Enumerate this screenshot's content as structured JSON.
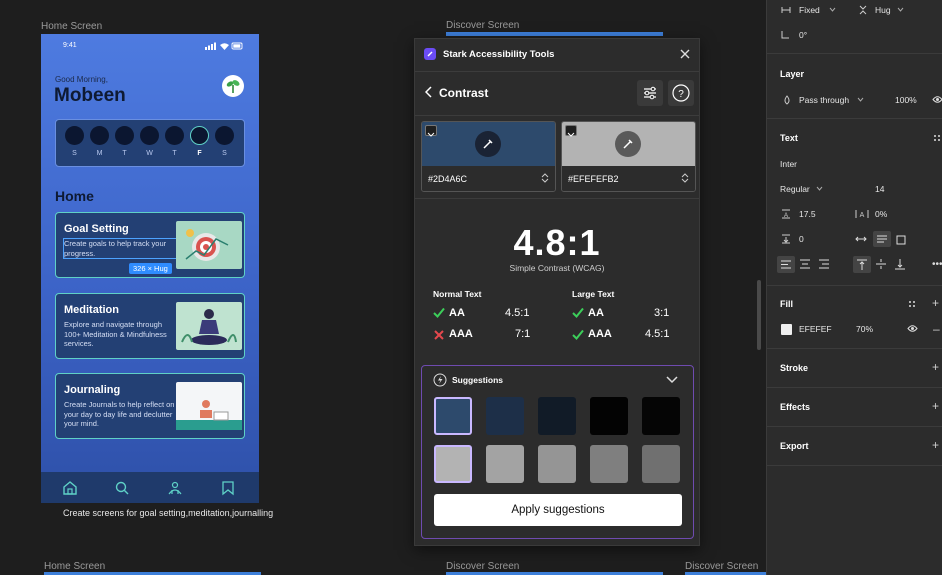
{
  "canvas": {
    "label_home_top": "Home Screen",
    "label_discover_top": "Discover Screen",
    "label_home_bottom": "Home Screen",
    "label_discover_bottom_1": "Discover Screen",
    "label_discover_bottom_2": "Discover Screen",
    "caption": "Create screens for goal setting,meditation,journalling"
  },
  "phone": {
    "time": "9:41",
    "greeting": "Good Morning,",
    "name": "Mobeen",
    "days": [
      "S",
      "M",
      "T",
      "W",
      "T",
      "F",
      "S"
    ],
    "section_title": "Home",
    "cards": [
      {
        "title": "Goal Setting",
        "desc": "Create goals to help track your progress."
      },
      {
        "title": "Meditation",
        "desc": "Explore and navigate through 100+ Meditation & Mindfulness services."
      },
      {
        "title": "Journaling",
        "desc": "Create Journals to help reflect on your day to day life and declutter your mind."
      }
    ],
    "selection_badge": "326 × Hug"
  },
  "stark": {
    "title": "Stark Accessibility Tools",
    "section": "Contrast",
    "fg_hex": "#2D4A6C",
    "bg_hex": "#EFEFEFB2",
    "fg_color": "#2d4a6c",
    "bg_color": "#b3b3b3",
    "ratio": "4.8:1",
    "ratio_sub": "Simple Contrast (WCAG)",
    "normal_label": "Normal Text",
    "large_label": "Large Text",
    "normal": [
      {
        "level": "AA",
        "ratio": "4.5:1",
        "pass": true
      },
      {
        "level": "AAA",
        "ratio": "7:1",
        "pass": false
      }
    ],
    "large": [
      {
        "level": "AA",
        "ratio": "3:1",
        "pass": true
      },
      {
        "level": "AAA",
        "ratio": "4.5:1",
        "pass": true
      }
    ],
    "suggestions_label": "Suggestions",
    "suggestion_row1": [
      "#2d4a6c",
      "#1d2f48",
      "#111b27",
      "#030303",
      "#050505"
    ],
    "suggestion_row2": [
      "#b3b3b3",
      "#a3a3a3",
      "#959595",
      "#7f7f7f",
      "#707070"
    ],
    "apply_label": "Apply suggestions"
  },
  "design_panel": {
    "width_mode": "Fixed",
    "height_mode": "Hug",
    "rotation": "0°",
    "layer_heading": "Layer",
    "blend_mode": "Pass through",
    "opacity": "100%",
    "text_heading": "Text",
    "font_family": "Inter",
    "font_weight": "Regular",
    "font_size": "14",
    "line_height": "17.5",
    "letter_spacing": "0%",
    "paragraph_spacing": "0",
    "fill_heading": "Fill",
    "fill_hex": "EFEFEF",
    "fill_opacity": "70%",
    "stroke_heading": "Stroke",
    "effects_heading": "Effects",
    "export_heading": "Export"
  }
}
